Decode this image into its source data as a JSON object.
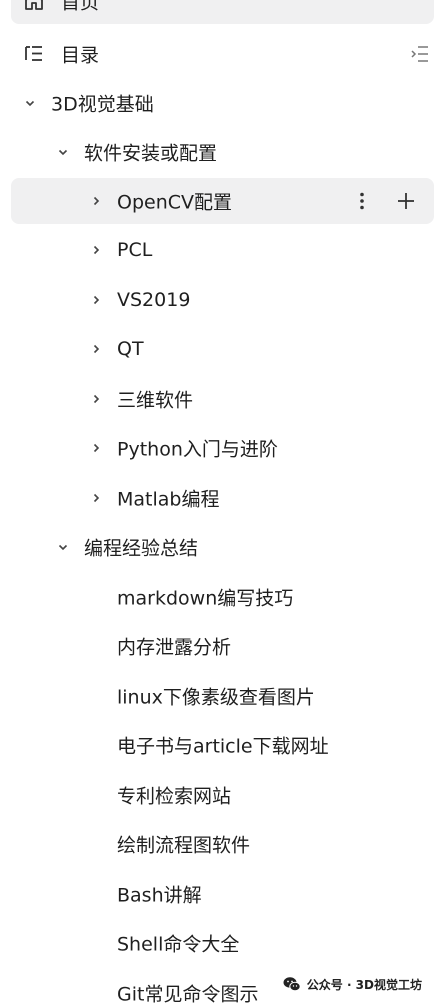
{
  "nav": {
    "home_label": "首页",
    "toc_label": "目录"
  },
  "tree": {
    "root": "3D视觉基础",
    "group1": {
      "label": "软件安装或配置",
      "items": [
        "OpenCV配置",
        "PCL",
        "VS2019",
        "QT",
        "三维软件",
        "Python入门与进阶",
        "Matlab编程"
      ]
    },
    "group2": {
      "label": "编程经验总结",
      "items": [
        "markdown编写技巧",
        "内存泄露分析",
        "linux下像素级查看图片",
        "电子书与article下载网址",
        "专利检索网站",
        "绘制流程图软件",
        "Bash讲解",
        "Shell命令大全",
        "Git常见命令图示"
      ]
    }
  },
  "icons": {
    "home": "home-icon",
    "toc": "toc-icon",
    "toc_toggle": "toc-expand-icon",
    "expand": "chevron-down-icon",
    "collapse": "chevron-right-icon",
    "more": "more-vertical-icon",
    "add": "plus-icon"
  },
  "watermark": {
    "text": "公众号 · 3D视觉工坊"
  },
  "colors": {
    "selected_bg": "#f0f0f1",
    "text": "#1f1f1f",
    "icon": "#555555"
  }
}
